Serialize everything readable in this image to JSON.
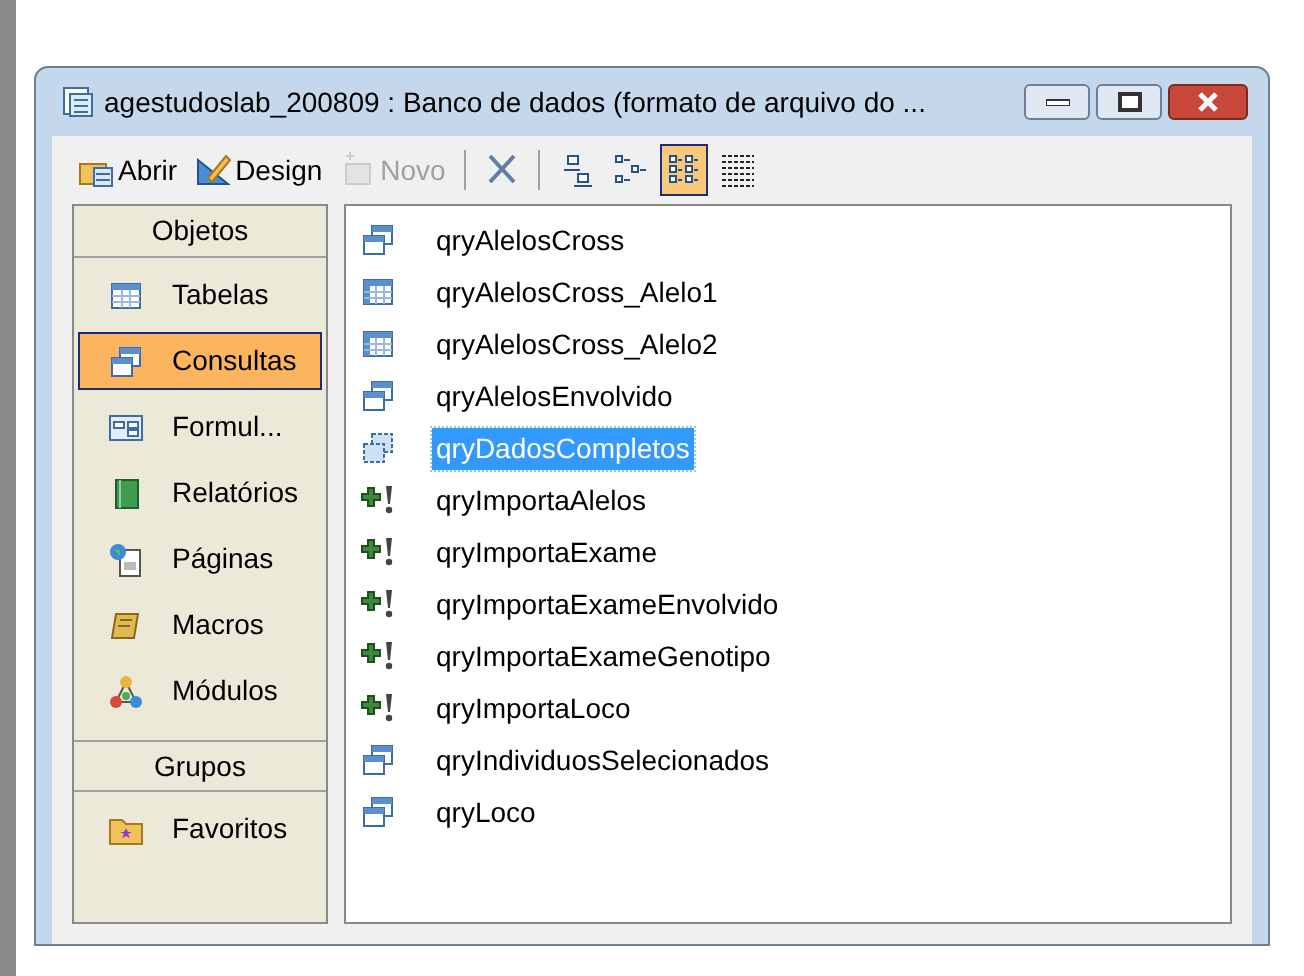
{
  "window": {
    "title": "agestudoslab_200809 : Banco de dados (formato de arquivo do ..."
  },
  "toolbar": [
    {
      "kind": "open",
      "label": "Abrir",
      "disabled": false,
      "selected": false
    },
    {
      "kind": "design",
      "label": "Design",
      "disabled": false,
      "selected": false
    },
    {
      "kind": "new",
      "label": "Novo",
      "disabled": true,
      "selected": false
    },
    {
      "kind": "separator"
    },
    {
      "kind": "delete",
      "disabled": false,
      "selected": false
    },
    {
      "kind": "separator"
    },
    {
      "kind": "large-icons",
      "disabled": false,
      "selected": false
    },
    {
      "kind": "small-icons",
      "disabled": false,
      "selected": false
    },
    {
      "kind": "list",
      "disabled": false,
      "selected": true
    },
    {
      "kind": "details",
      "disabled": false,
      "selected": false
    }
  ],
  "sidebar": {
    "sections": [
      {
        "title": "Objetos",
        "items": [
          {
            "kind": "table",
            "label": "Tabelas",
            "selected": false
          },
          {
            "kind": "query",
            "label": "Consultas",
            "selected": true
          },
          {
            "kind": "form",
            "label": "Formul...",
            "selected": false
          },
          {
            "kind": "report",
            "label": "Relatórios",
            "selected": false
          },
          {
            "kind": "page",
            "label": "Páginas",
            "selected": false
          },
          {
            "kind": "macro",
            "label": "Macros",
            "selected": false
          },
          {
            "kind": "module",
            "label": "Módulos",
            "selected": false
          }
        ]
      },
      {
        "title": "Grupos",
        "items": [
          {
            "kind": "favorites",
            "label": "Favoritos",
            "selected": false
          }
        ]
      }
    ]
  },
  "list": {
    "items": [
      {
        "kind": "select",
        "label": "qryAlelosCross",
        "selected": false
      },
      {
        "kind": "crosstab",
        "label": "qryAlelosCross_Alelo1",
        "selected": false
      },
      {
        "kind": "crosstab",
        "label": "qryAlelosCross_Alelo2",
        "selected": false
      },
      {
        "kind": "select",
        "label": "qryAlelosEnvolvido",
        "selected": false
      },
      {
        "kind": "union",
        "label": "qryDadosCompletos",
        "selected": true
      },
      {
        "kind": "append",
        "label": "qryImportaAlelos",
        "selected": false
      },
      {
        "kind": "append",
        "label": "qryImportaExame",
        "selected": false
      },
      {
        "kind": "append",
        "label": "qryImportaExameEnvolvido",
        "selected": false
      },
      {
        "kind": "append",
        "label": "qryImportaExameGenotipo",
        "selected": false
      },
      {
        "kind": "append",
        "label": "qryImportaLoco",
        "selected": false
      },
      {
        "kind": "select",
        "label": "qryIndividuosSelecionados",
        "selected": false
      },
      {
        "kind": "select",
        "label": "qryLoco",
        "selected": false
      }
    ]
  }
}
